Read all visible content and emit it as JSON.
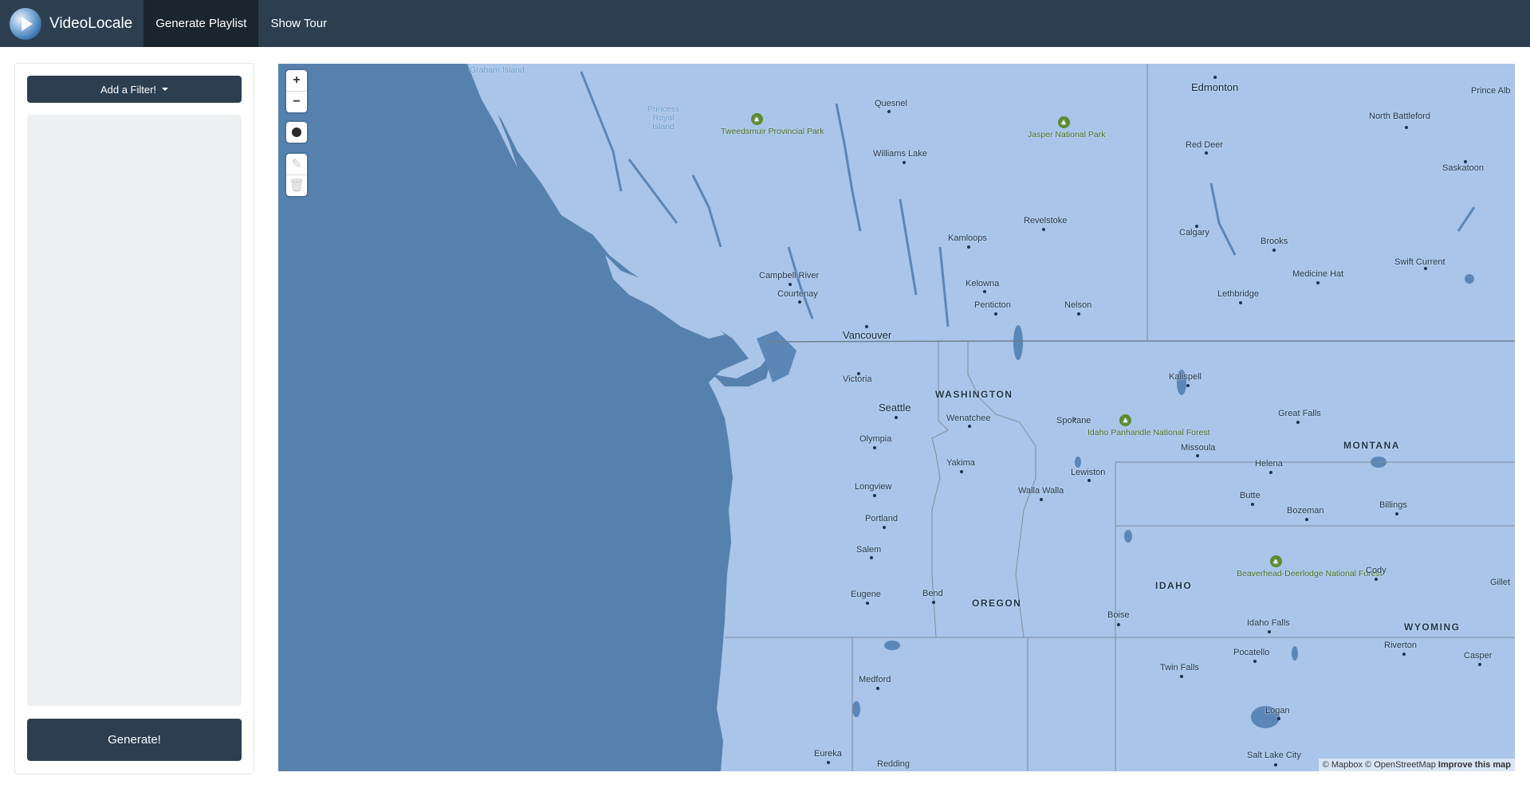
{
  "navbar": {
    "brand": "VideoLocale",
    "logo_icon": "video-globe-logo",
    "items": [
      {
        "label": "Generate Playlist",
        "active": true
      },
      {
        "label": "Show Tour",
        "active": false
      }
    ],
    "colors": {
      "bar": "#2c3e50",
      "active": "#1a252f"
    }
  },
  "sidebar": {
    "filter_button": "Add a Filter!",
    "generate_button": "Generate!"
  },
  "map": {
    "controls": {
      "zoom_in": "+",
      "zoom_out": "−",
      "draw_point_icon": "circle-icon",
      "edit_icon": "edit-icon",
      "trash_icon": "trash-icon"
    },
    "labels": {
      "graham_island": "Graham Island",
      "princess_royal": "Princess Royal Island",
      "tweedsmuir": "Tweedsmuir Provincial Park",
      "quesnel": "Quesnel",
      "williams_lake": "Williams Lake",
      "jasper": "Jasper National Park",
      "edmonton": "Edmonton",
      "red_deer": "Red Deer",
      "north_battleford": "North Battleford",
      "saskatoon": "Saskatoon",
      "prince_albert": "Prince Alb",
      "kamloops": "Kamloops",
      "revelstoke": "Revelstoke",
      "calgary": "Calgary",
      "brooks": "Brooks",
      "medicine_hat": "Medicine Hat",
      "swift_current": "Swift Current",
      "lethbridge": "Lethbridge",
      "campbell_river": "Campbell River",
      "courtenay": "Courtenay",
      "kelowna": "Kelowna",
      "penticton": "Penticton",
      "nelson": "Nelson",
      "vancouver": "Vancouver",
      "victoria": "Victoria",
      "kalispell": "Kalispell",
      "washington": "WASHINGTON",
      "seattle": "Seattle",
      "wenatchee": "Wenatchee",
      "spokane": "Spokane",
      "idaho_panhandle": "Idaho Panhandle National Forest",
      "great_falls": "Great Falls",
      "olympia": "Olympia",
      "missoula": "Missoula",
      "montana": "MONTANA",
      "yakima": "Yakima",
      "helena": "Helena",
      "lewiston": "Lewiston",
      "walla_walla": "Walla Walla",
      "longview": "Longview",
      "butte": "Butte",
      "billings": "Billings",
      "portland": "Portland",
      "bozeman": "Bozeman",
      "salem": "Salem",
      "beaverhead": "Beaverhead-Deerlodge National Forest",
      "cody": "Cody",
      "gillette": "Gillet",
      "idaho": "IDAHO",
      "eugene": "Eugene",
      "bend": "Bend",
      "oregon": "OREGON",
      "boise": "Boise",
      "idaho_falls": "Idaho Falls",
      "wyoming": "WYOMING",
      "riverton": "Riverton",
      "casper": "Casper",
      "pocatello": "Pocatello",
      "twin_falls": "Twin Falls",
      "medford": "Medford",
      "logan": "Logan",
      "eureka": "Eureka",
      "salt_lake_city": "Salt Lake City",
      "redding": "Redding"
    },
    "attribution": {
      "mapbox": "© Mapbox",
      "osm": "© OpenStreetMap",
      "improve": "Improve this map"
    },
    "colors": {
      "ocean": "#5781ad",
      "land": "#a9c5e9",
      "lakes": "#5b86b6",
      "borders": "#7f8c9a"
    }
  }
}
